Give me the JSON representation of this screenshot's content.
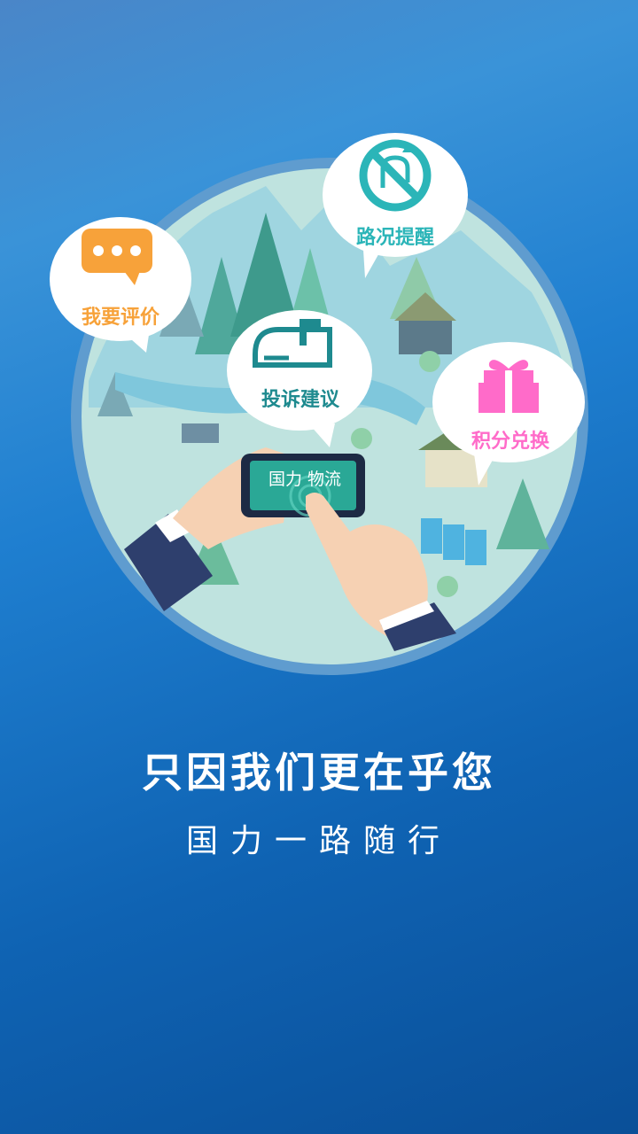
{
  "bubbles": {
    "review": {
      "label": "我要评价",
      "icon": "chat-dots-icon",
      "color": "#f7a23a"
    },
    "traffic": {
      "label": "路况提醒",
      "icon": "no-u-turn-icon",
      "color": "#2bb5b8"
    },
    "complaint": {
      "label": "投诉建议",
      "icon": "mailbox-icon",
      "color": "#1e8a8f"
    },
    "points": {
      "label": "积分兑换",
      "icon": "gift-icon",
      "color": "#ff6bc9"
    }
  },
  "phone": {
    "screen_text": "国力 物流"
  },
  "slogan": {
    "main": "只因我们更在乎您",
    "sub": "国力一路随行"
  }
}
